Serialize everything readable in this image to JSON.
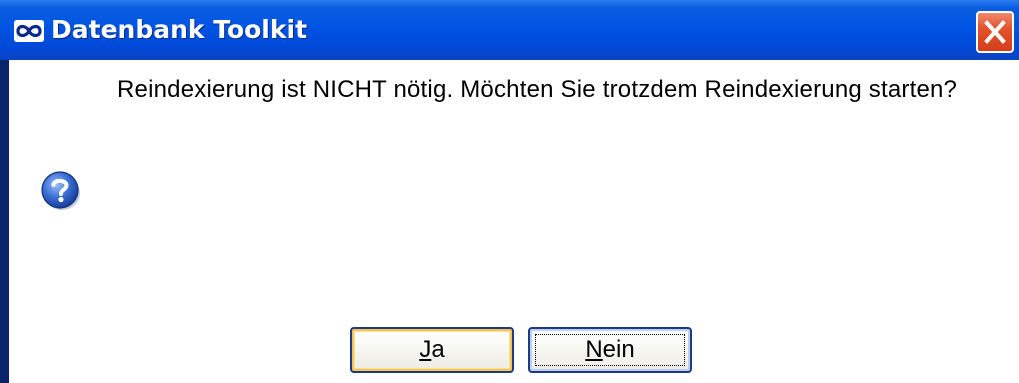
{
  "window": {
    "title": "Datenbank Toolkit",
    "app_icon": "infinity-logo-icon",
    "close_icon": "close-icon"
  },
  "dialog": {
    "message": "Reindexierung ist NICHT nötig. Möchten Sie trotzdem Reindexierung starten?",
    "icon": "question-icon",
    "buttons": {
      "yes": {
        "accel": "J",
        "rest": "a"
      },
      "no": {
        "accel": "N",
        "rest": "ein"
      }
    }
  },
  "colors": {
    "titlebar": "#0054e3",
    "close_button": "#d43d1a",
    "button_border": "#1d3a87",
    "default_highlight": "#f5c552"
  }
}
